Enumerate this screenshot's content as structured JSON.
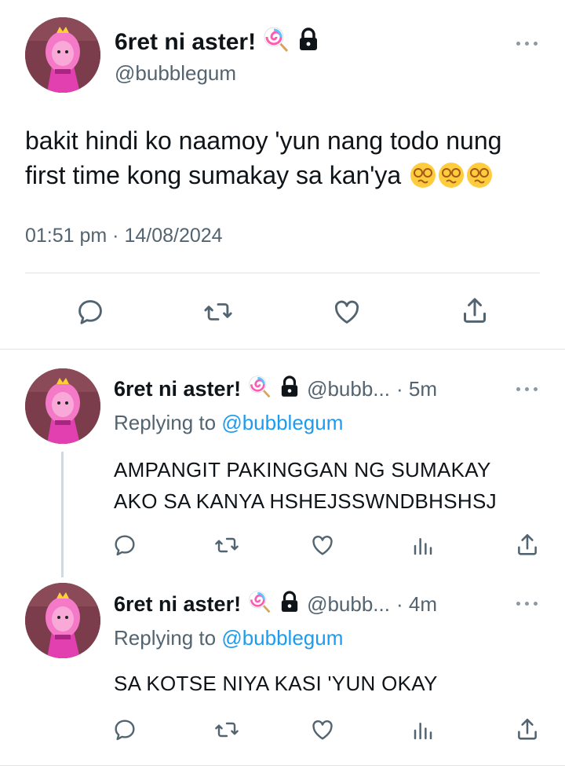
{
  "main_tweet": {
    "display_name": "6ret ni aster!",
    "handle": "@bubblegum",
    "text": "bakit hindi ko naamoy 'yun nang todo nung first time kong sumakay sa kan'ya",
    "timestamp": "01:51 pm · 14/08/2024",
    "icons": [
      "lollipop-emoji",
      "lock-icon",
      "more-icon",
      "dizzy-face-emoji"
    ]
  },
  "replies": [
    {
      "display_name": "6ret ni aster!",
      "handle_short": "@bubb...",
      "time": "· 5m",
      "replying_label": "Replying to",
      "replying_handle": "@bubblegum",
      "text_lines": [
        "AMPANGIT PAKINGGAN NG SUMAKAY",
        "AKO SA KANYA HSHEJSSWNDBHSHSJ"
      ]
    },
    {
      "display_name": "6ret ni aster!",
      "handle_short": "@bubb...",
      "time": "· 4m",
      "replying_label": "Replying to",
      "replying_handle": "@bubblegum",
      "text_lines": [
        "SA KOTSE NIYA KASI 'YUN OKAY"
      ]
    }
  ],
  "actions": [
    "reply-icon",
    "retweet-icon",
    "like-icon",
    "views-icon",
    "share-icon"
  ],
  "colors": {
    "accent": "#1d9bf0",
    "muted": "#536471",
    "text": "#0f1419",
    "divider": "#e1e5e8"
  }
}
